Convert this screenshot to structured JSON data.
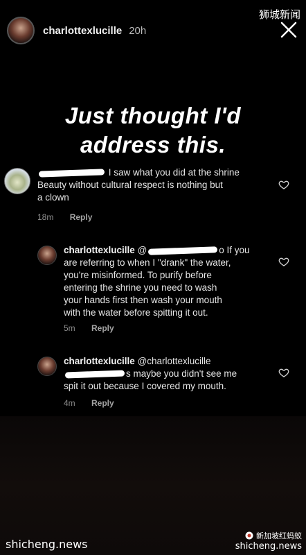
{
  "story": {
    "username": "charlottexlucille",
    "time": "20h",
    "caption_line1": "Just thought I'd",
    "caption_line2": "address this."
  },
  "watermarks": {
    "top_right": "狮城新闻",
    "bottom_left": "shicheng.news",
    "bottom_right_top": "新加坡红蚂蚁",
    "bottom_right_bottom": "shicheng.news"
  },
  "comments": [
    {
      "text_line1": "I saw what you did at the shrine",
      "text_line2": "Beauty without cultural respect is nothing but",
      "text_line3": "a clown",
      "time": "18m",
      "reply": "Reply"
    },
    {
      "username": "charlottexlucille",
      "mention_prefix": "@",
      "line1_suffix": "o If you",
      "line2": "are referring to when I \"drank\" the water,",
      "line3": "you're misinformed. To purify before",
      "line4": "entering the shrine you need to wash",
      "line5": "your hands first then wash your mouth",
      "line6": "with the water before spitting it out.",
      "time": "5m",
      "reply": "Reply"
    },
    {
      "username": "charlottexlucille",
      "mention": "@charlottexlucille",
      "line2_suffix": "s maybe you didn't see me",
      "line3": "spit it out because I covered my mouth.",
      "time": "4m",
      "reply": "Reply"
    }
  ],
  "icons": {
    "close": "close-icon",
    "like": "heart-icon",
    "brand": "ant-icon"
  },
  "colors": {
    "background": "#000000",
    "text": "#e6e6e6",
    "meta": "#8d8d8d"
  }
}
